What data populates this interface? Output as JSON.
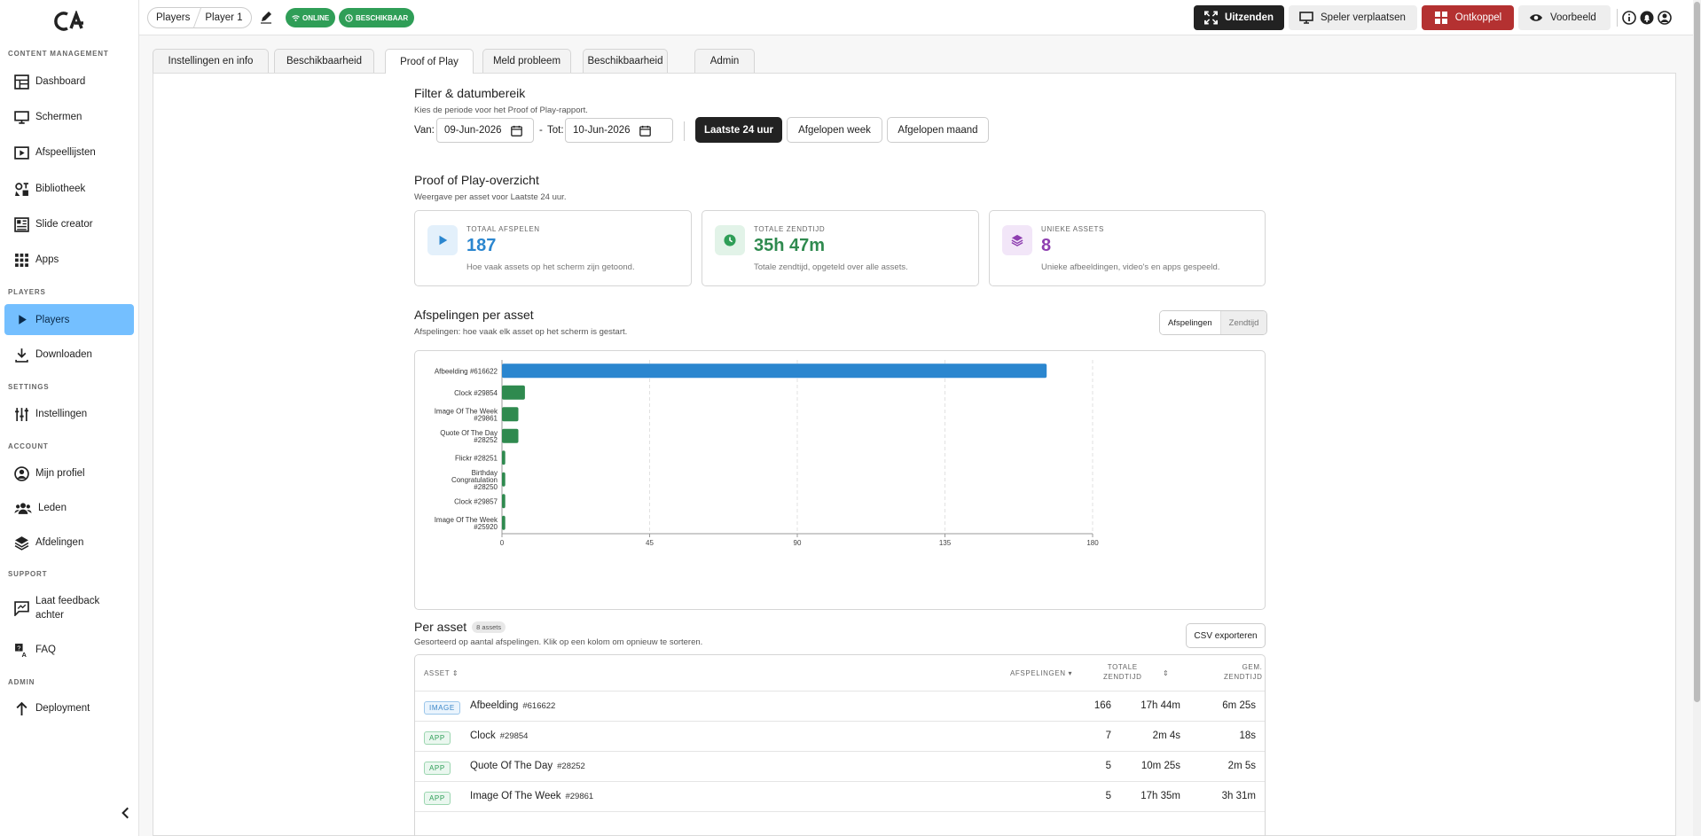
{
  "sidebar": {
    "sections": {
      "content": "CONTENT MANAGEMENT",
      "players": "PLAYERS",
      "settings": "SETTINGS",
      "account": "ACCOUNT",
      "support": "SUPPORT",
      "admin": "ADMIN"
    },
    "items": {
      "dashboard": "Dashboard",
      "schermen": "Schermen",
      "afspeellijsten": "Afspeellijsten",
      "bibliotheek": "Bibliotheek",
      "slide_creator": "Slide creator",
      "apps": "Apps",
      "players": "Players",
      "downloaden": "Downloaden",
      "instellingen": "Instellingen",
      "mijn_profiel": "Mijn profiel",
      "leden": "Leden",
      "afdelingen": "Afdelingen",
      "feedback_1": "Laat feedback",
      "feedback_2": "achter",
      "faq": "FAQ",
      "deployment": "Deployment"
    },
    "active_item": "Players"
  },
  "topbar": {
    "breadcrumb": [
      "Players",
      "Player 1"
    ],
    "badges": {
      "online": "ONLINE",
      "available": "BESCHIKBAAR"
    },
    "buttons": {
      "uitzenden": "Uitzenden",
      "verplaatsen": "Speler verplaatsen",
      "ontkoppel": "Ontkoppel",
      "voorbeeld": "Voorbeeld"
    }
  },
  "tabs": [
    "Instellingen en info",
    "Beschikbaarheid",
    "Proof of Play",
    "Meld probleem",
    "Beschikbaarheid",
    "Admin"
  ],
  "active_tab": "Proof of Play",
  "filter": {
    "title": "Filter & datumbereik",
    "subtitle": "Kies de periode voor het Proof of Play-rapport.",
    "from_label": "Van:",
    "from_value": "09-Jun-2026",
    "dash": "-",
    "to_label": "Tot:",
    "to_value": "10-Jun-2026",
    "range_buttons": [
      "Laatste 24 uur",
      "Afgelopen week",
      "Afgelopen maand"
    ],
    "active_range": "Laatste 24 uur"
  },
  "overview": {
    "title": "Proof of Play-overzicht",
    "subtitle": "Weergave per asset voor Laatste 24 uur.",
    "cards": [
      {
        "label": "TOTAAL AFSPELEN",
        "value": "187",
        "desc": "Hoe vaak assets op het scherm zijn getoond.",
        "color": "#2b86cf"
      },
      {
        "label": "TOTALE ZENDTIJD",
        "value": "35h 47m",
        "desc": "Totale zendtijd, opgeteld over alle assets.",
        "color": "#2f9e57"
      },
      {
        "label": "UNIEKE ASSETS",
        "value": "8",
        "desc": "Unieke afbeeldingen, video's en apps gespeeld.",
        "color": "#8e3fb0"
      }
    ]
  },
  "per_asset_chart": {
    "title": "Afspelingen per asset",
    "subtitle": "Afspelingen: hoe vaak elk asset op het scherm is gestart.",
    "toggle": [
      "Afspelingen",
      "Zendtijd"
    ],
    "toggle_active": "Afspelingen"
  },
  "chart_data": {
    "type": "bar",
    "orientation": "horizontal",
    "categories": [
      [
        "Afbeelding #616622"
      ],
      [
        "Clock #29854"
      ],
      [
        "Image Of The Week",
        "#29861"
      ],
      [
        "Quote Of The Day",
        "#28252"
      ],
      [
        "Flickr #28251"
      ],
      [
        "Birthday",
        "Congratulation",
        "#28250"
      ],
      [
        "Clock #29857"
      ],
      [
        "Image Of The Week",
        "#25920"
      ]
    ],
    "values": [
      166,
      7,
      5,
      5,
      1,
      1,
      1,
      1
    ],
    "bar_colors": [
      "#2b86cf",
      "#2f8a4f",
      "#2f8a4f",
      "#2f8a4f",
      "#2f8a4f",
      "#2f8a4f",
      "#2f8a4f",
      "#2f8a4f"
    ],
    "xlim": [
      0,
      180
    ],
    "xticks": [
      0,
      45,
      90,
      135,
      180
    ],
    "grid": true
  },
  "table": {
    "title": "Per asset",
    "count_badge": "8 assets",
    "subtitle": "Gesorteerd op aantal afspelingen. Klik op een kolom om opnieuw te sorteren.",
    "export_button": "CSV exporteren",
    "headers": {
      "asset": "ASSET",
      "plays": "AFSPELINGEN",
      "total_1": "TOTALE",
      "total_2": "ZENDTIJD",
      "avg_1": "GEM.",
      "avg_2": "ZENDTIJD"
    },
    "rows": [
      {
        "type": "IMAGE",
        "name": "Afbeelding",
        "id": "#616622",
        "plays": "166",
        "total": "17h 44m",
        "avg": "6m 25s"
      },
      {
        "type": "APP",
        "name": "Clock",
        "id": "#29854",
        "plays": "7",
        "total": "2m 4s",
        "avg": "18s"
      },
      {
        "type": "APP",
        "name": "Quote Of The Day",
        "id": "#28252",
        "plays": "5",
        "total": "10m 25s",
        "avg": "2m 5s"
      },
      {
        "type": "APP",
        "name": "Image Of The Week",
        "id": "#29861",
        "plays": "5",
        "total": "17h 35m",
        "avg": "3h 31m"
      }
    ]
  }
}
